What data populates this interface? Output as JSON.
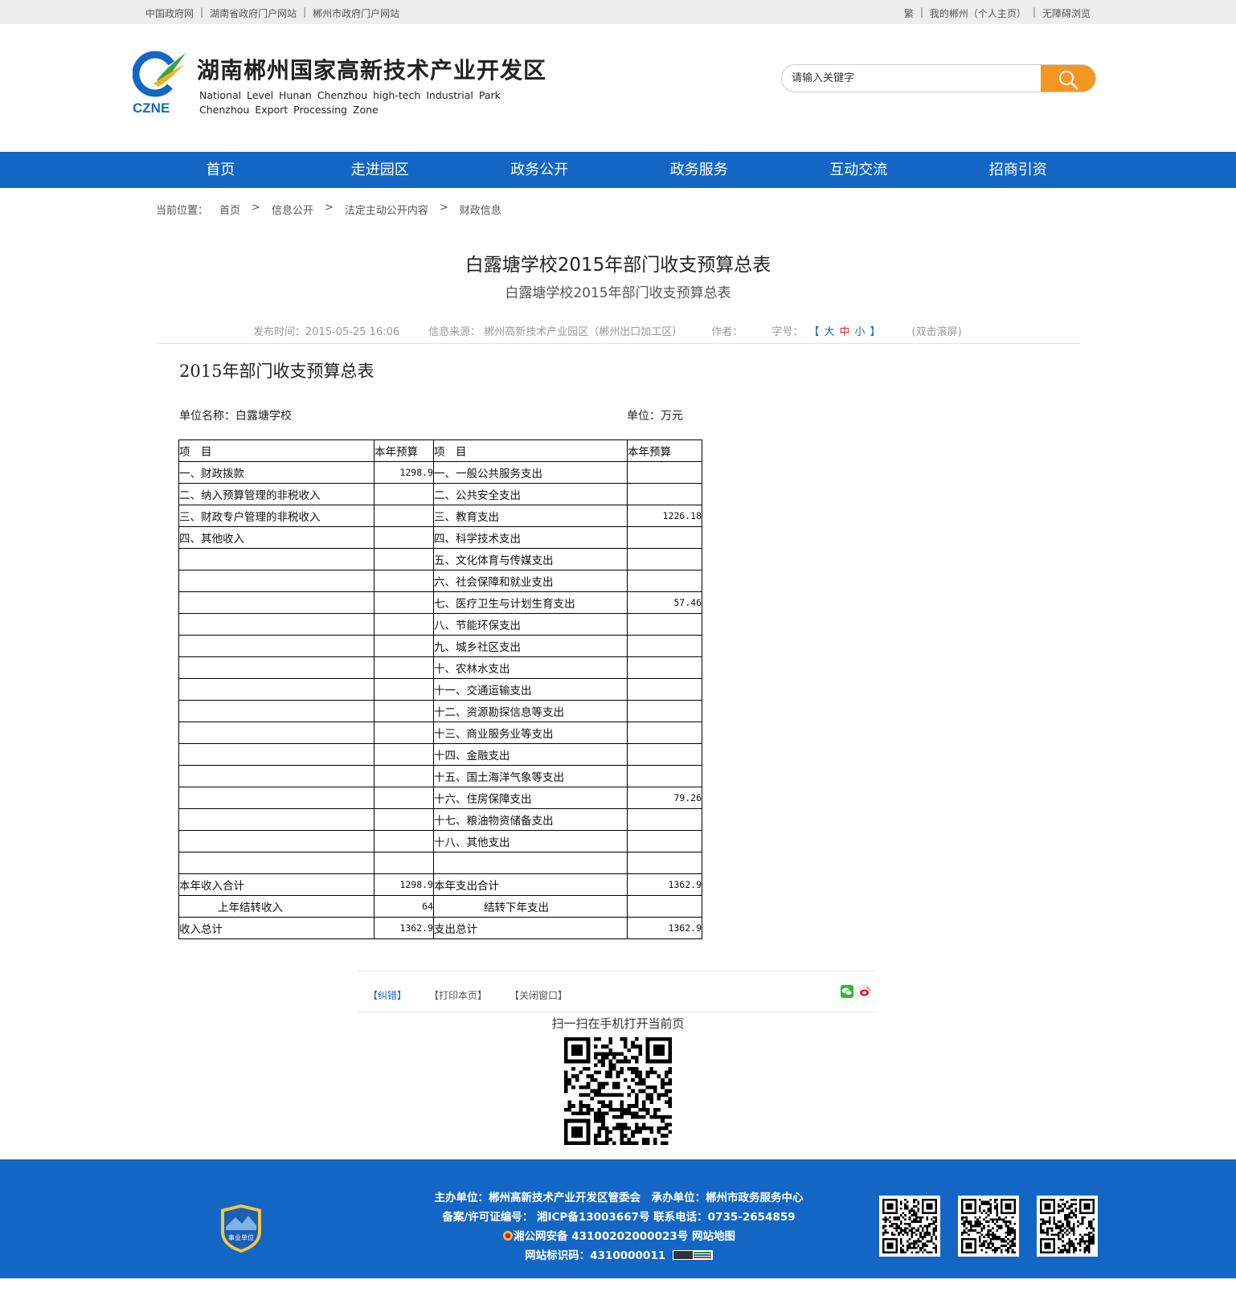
{
  "topbar": {
    "links_left": [
      "中国政府网",
      "湖南省政府门户网站",
      "郴州市政府门户网站"
    ],
    "links_right": [
      "繁",
      "我的郴州（个人主页）",
      "无障碍浏览"
    ]
  },
  "header": {
    "logo_text": "CZNE",
    "title": "湖南郴州国家高新技术产业开发区",
    "en_line1": "National  Level  Hunan  Chenzhou high-tech  Industrial  Park",
    "en_line2": "Chenzhou  Export  Processing  Zone",
    "search_placeholder": "请输入关键字"
  },
  "nav": [
    "首页",
    "走进园区",
    "政务公开",
    "政务服务",
    "互动交流",
    "招商引资"
  ],
  "breadcrumb": {
    "label": "当前位置：",
    "items": [
      "首页",
      "信息公开",
      "法定主动公开内容",
      "财政信息"
    ],
    "sep": ">"
  },
  "article": {
    "title": "白露塘学校2015年部门收支预算总表",
    "subtitle": "白露塘学校2015年部门收支预算总表",
    "publish_time": "发布时间：2015-05-25 16:06",
    "source": "信息来源： 郴州高新技术产业园区（郴州出口加工区）",
    "author": "作者：",
    "font_label": "字号：",
    "font_open": "【",
    "font_big": "大",
    "font_mid": "中",
    "font_small": "小",
    "font_close": "】",
    "dblclick": "(双击滚屏)"
  },
  "content": {
    "heading": "2015年部门收支预算总表",
    "unit_name": "单位名称：白露塘学校",
    "unit": "单位：万元",
    "table": {
      "header": [
        "项　目",
        "本年预算",
        "项　目",
        "本年预算"
      ],
      "rows": [
        [
          "一、财政拨款",
          "1298.9",
          "一、一般公共服务支出",
          ""
        ],
        [
          "二、纳入预算管理的非税收入",
          "",
          "二、公共安全支出",
          ""
        ],
        [
          "三、财政专户管理的非税收入",
          "",
          "三、教育支出",
          "1226.18"
        ],
        [
          "四、其他收入",
          "",
          "四、科学技术支出",
          ""
        ],
        [
          "",
          "",
          "五、文化体育与传媒支出",
          ""
        ],
        [
          "",
          "",
          "六、社会保障和就业支出",
          ""
        ],
        [
          "",
          "",
          "七、医疗卫生与计划生育支出",
          "57.46"
        ],
        [
          "",
          "",
          "八、节能环保支出",
          ""
        ],
        [
          "",
          "",
          "九、城乡社区支出",
          ""
        ],
        [
          "",
          "",
          "十、农林水支出",
          ""
        ],
        [
          "",
          "",
          "十一、交通运输支出",
          ""
        ],
        [
          "",
          "",
          "十二、资源勘探信息等支出",
          ""
        ],
        [
          "",
          "",
          "十三、商业服务业等支出",
          ""
        ],
        [
          "",
          "",
          "十四、金融支出",
          ""
        ],
        [
          "",
          "",
          "十五、国土海洋气象等支出",
          ""
        ],
        [
          "",
          "",
          "十六、住房保障支出",
          "79.26"
        ],
        [
          "",
          "",
          "十七、粮油物资储备支出",
          ""
        ],
        [
          "",
          "",
          "十八、其他支出",
          ""
        ],
        [
          "",
          "",
          "",
          ""
        ]
      ],
      "totals": [
        [
          "本年收入合计",
          "1298.9",
          "本年支出合计",
          "1362.9"
        ],
        [
          "上年结转收入",
          "64",
          "结转下年支出",
          ""
        ],
        [
          "收入总计",
          "1362.9",
          "支出总计",
          "1362.9"
        ]
      ]
    }
  },
  "tools": {
    "correct": "【纠错】",
    "print": "【打印本页】",
    "close": "【关闭窗口】",
    "qr_caption": "扫一扫在手机打开当前页"
  },
  "footer": {
    "badge_text": "事业单位",
    "line1": "主办单位：郴州高新技术产业开发区管委会　承办单位：郴州市政务服务中心",
    "line2": "备案/许可证编号： 湘ICP备13003667号 联系电话：0735-2654859",
    "line3": "湘公网安备 43100202000023号 网站地图",
    "line4": "网站标识码：4310000011"
  },
  "colors": {
    "nav_blue": "#1466c4",
    "search_orange": "#f39722",
    "topbar_gray": "#eeeeee"
  }
}
